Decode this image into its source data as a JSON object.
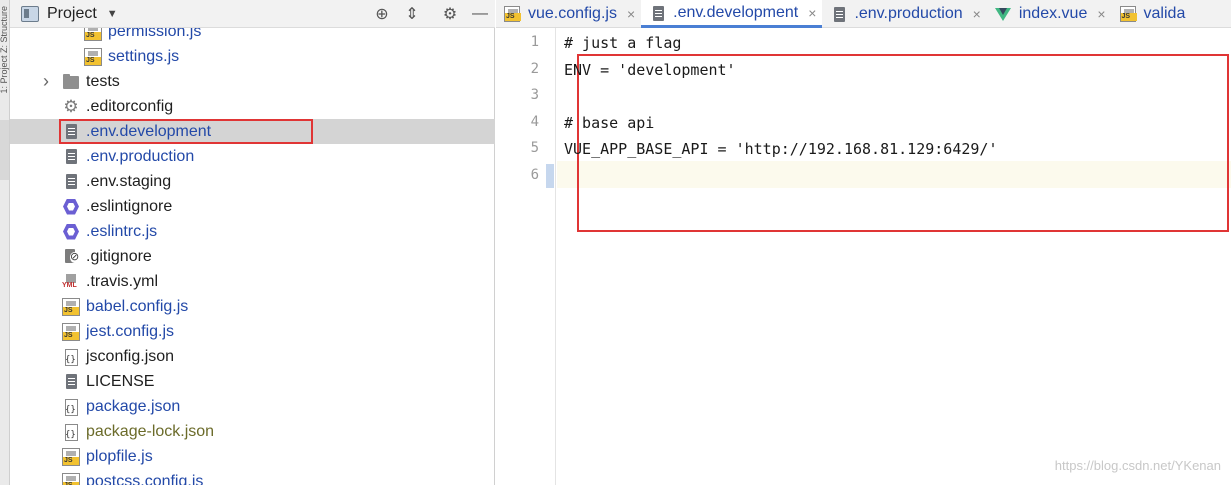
{
  "side_strip": {
    "label": "1: Project  Z: Structure"
  },
  "project_panel": {
    "title": "Project",
    "tools": [
      {
        "name": "locate-icon",
        "glyph": "⊕"
      },
      {
        "name": "collapse-icon",
        "glyph": "⇕"
      },
      {
        "name": "gear-icon",
        "glyph": "⚙"
      },
      {
        "name": "minimize-icon",
        "glyph": "—"
      }
    ],
    "tree": [
      {
        "label": "permission.js",
        "icon": "js",
        "color": "blue",
        "indent": 1
      },
      {
        "label": "settings.js",
        "icon": "js",
        "color": "blue",
        "indent": 1
      },
      {
        "label": "tests",
        "icon": "folder",
        "color": "black",
        "arrow": "›"
      },
      {
        "label": ".editorconfig",
        "icon": "gear",
        "color": "black"
      },
      {
        "label": ".env.development",
        "icon": "file",
        "color": "blue",
        "selected": true
      },
      {
        "label": ".env.production",
        "icon": "file",
        "color": "blue"
      },
      {
        "label": ".env.staging",
        "icon": "file",
        "color": "black"
      },
      {
        "label": ".eslintignore",
        "icon": "eslint",
        "color": "black"
      },
      {
        "label": ".eslintrc.js",
        "icon": "eslint",
        "color": "blue"
      },
      {
        "label": ".gitignore",
        "icon": "ignore",
        "color": "black"
      },
      {
        "label": ".travis.yml",
        "icon": "yml",
        "color": "black"
      },
      {
        "label": "babel.config.js",
        "icon": "js",
        "color": "blue"
      },
      {
        "label": "jest.config.js",
        "icon": "js",
        "color": "blue"
      },
      {
        "label": "jsconfig.json",
        "icon": "json",
        "color": "black"
      },
      {
        "label": "LICENSE",
        "icon": "file",
        "color": "black"
      },
      {
        "label": "package.json",
        "icon": "json",
        "color": "blue"
      },
      {
        "label": "package-lock.json",
        "icon": "json",
        "color": "olive"
      },
      {
        "label": "plopfile.js",
        "icon": "js",
        "color": "blue"
      },
      {
        "label": "postcss.config.js",
        "icon": "js",
        "color": "blue"
      }
    ]
  },
  "editor": {
    "tabs": [
      {
        "label": "vue.config.js",
        "icon": "js",
        "active": false,
        "close": "×"
      },
      {
        "label": ".env.development",
        "icon": "file",
        "active": true,
        "close": "×"
      },
      {
        "label": ".env.production",
        "icon": "file",
        "active": false,
        "close": "×"
      },
      {
        "label": "index.vue",
        "icon": "vue",
        "active": false,
        "close": "×"
      },
      {
        "label": "valida",
        "icon": "js",
        "active": false,
        "close": ""
      }
    ],
    "lines": [
      {
        "no": "1",
        "code": "# just a flag"
      },
      {
        "no": "2",
        "code": "ENV = 'development'"
      },
      {
        "no": "3",
        "code": ""
      },
      {
        "no": "4",
        "code": "# base api"
      },
      {
        "no": "5",
        "code": "VUE_APP_BASE_API = 'http://192.168.81.129:6429/'"
      },
      {
        "no": "6",
        "code": ""
      }
    ],
    "current_line": 6
  },
  "watermark": "https://blog.csdn.net/YKenan",
  "colors": {
    "annotation": "#e03535",
    "link_blue": "#2349a8",
    "selected_row": "#d4d4d4"
  }
}
